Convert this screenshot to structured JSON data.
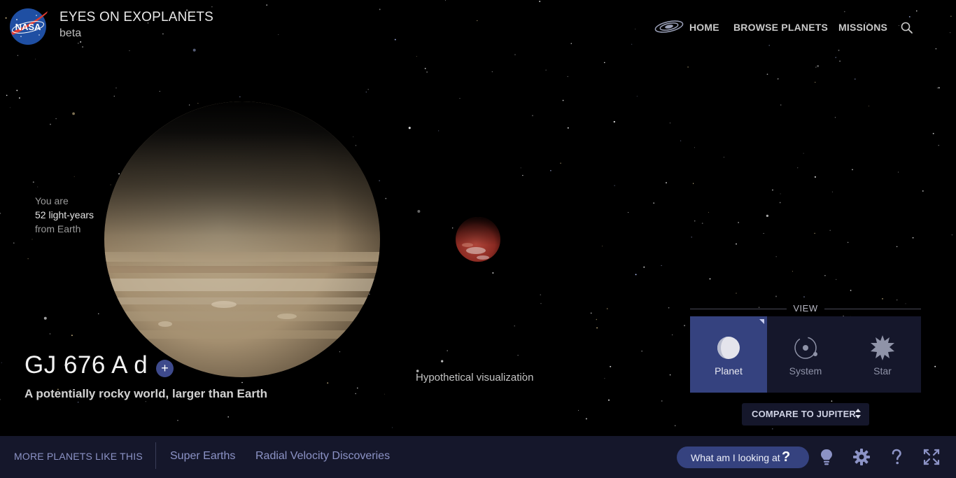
{
  "header": {
    "logo_text": "NASA",
    "title": "EYES ON EXOPLANETS",
    "subtitle": "beta",
    "nav": [
      {
        "label": "HOME"
      },
      {
        "label": "BROWSE PLANETS"
      },
      {
        "label": "MISSIONS"
      }
    ],
    "nav_home_icon": "galaxy-icon",
    "search_icon": "search-icon"
  },
  "distance": {
    "line1": "You are",
    "line2": "52 light-years",
    "line3": "from Earth"
  },
  "planet": {
    "name": "GJ 676 A d",
    "add_label": "+",
    "description": "A potentially rocky world, larger than Earth",
    "visualization_note": "Hypothetical visualization"
  },
  "view": {
    "label": "VIEW",
    "options": [
      {
        "label": "Planet",
        "icon": "planet-icon",
        "active": true
      },
      {
        "label": "System",
        "icon": "system-orbit-icon",
        "active": false
      },
      {
        "label": "Star",
        "icon": "star-burst-icon",
        "active": false
      }
    ],
    "compare_label": "COMPARE TO JUPITER"
  },
  "bottom_bar": {
    "more_like_label": "MORE PLANETS LIKE THIS",
    "links": [
      {
        "label": "Super Earths"
      },
      {
        "label": "Radial Velocity Discoveries"
      }
    ],
    "help_button_label": "What am I looking at",
    "help_button_glyph": "?",
    "icons": [
      "lightbulb-icon",
      "settings-gear-icon",
      "help-question-icon",
      "fullscreen-icon"
    ]
  },
  "colors": {
    "background": "#000000",
    "panel": "#15172b",
    "accent": "#35427f",
    "link": "#8c93c6"
  }
}
